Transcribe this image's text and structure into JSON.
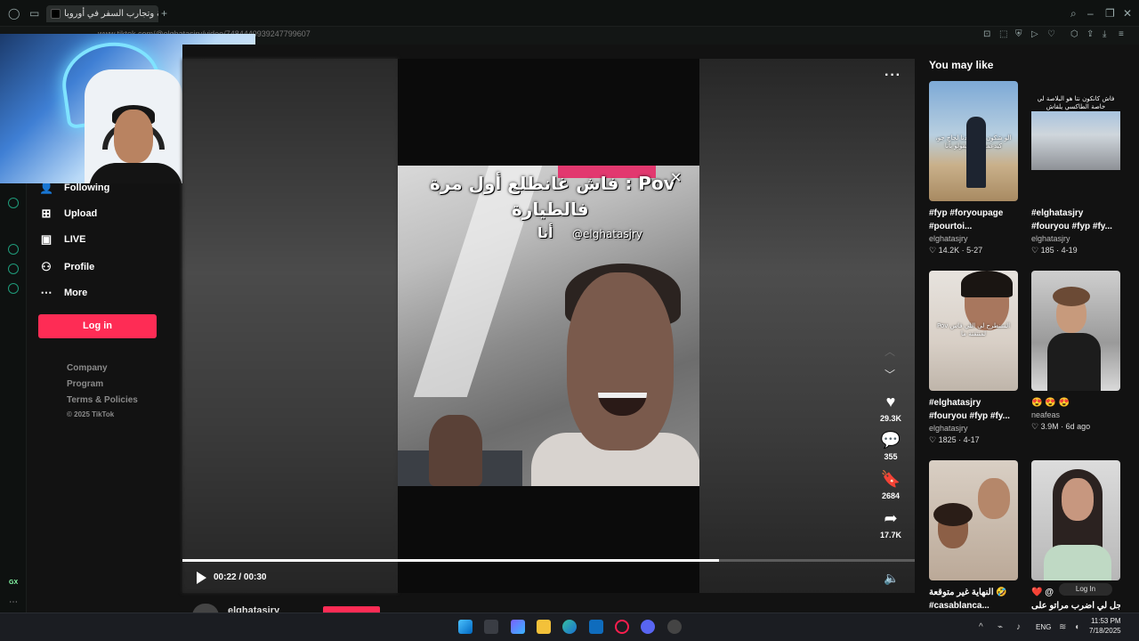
{
  "browser": {
    "tab_title": "القرية وتجارب السفر في أوروبا",
    "url": "www.tiktok.com/@elghatasjry/video/7484440939247799607"
  },
  "sidebar": {
    "items": [
      {
        "label": "Following",
        "icon": "following-icon"
      },
      {
        "label": "Upload",
        "icon": "upload-icon"
      },
      {
        "label": "LIVE",
        "icon": "live-icon"
      },
      {
        "label": "Profile",
        "icon": "profile-icon"
      },
      {
        "label": "More",
        "icon": "more-icon"
      }
    ],
    "login_label": "Log in",
    "footer": [
      "Company",
      "Program",
      "Terms & Policies"
    ],
    "copyright": "© 2025 TikTok"
  },
  "video": {
    "overlay_line1": "فاش غانطلع أول مرة : Pov",
    "overlay_line2": "فالطيارة",
    "overlay_line3": "أنا",
    "watermark": "@elghatasjry",
    "likes": "29.3K",
    "comments": "355",
    "saves": "2684",
    "shares": "17.7K",
    "time": "00:22 / 00:30",
    "progress": 0.733,
    "author": "elghatasjry"
  },
  "rail": {
    "title": "You may like",
    "cards": [
      {
        "title1": "#fyp #foryoupage",
        "title2": "#pourtoi...",
        "user": "elghatasjry",
        "likes": "14.2K",
        "date": "5-27",
        "caption": "الو شكون جي عندنا لجاج جو، كيدعمو تلي كيقولو بأنا"
      },
      {
        "title1": "#elghatasjry",
        "title2": "#fouryou #fyp #fy...",
        "user": "elghatasjry",
        "likes": "185",
        "date": "4-19",
        "caption": "فاش كانكون نتا هو البلاصة لي خاصة الطاكسي يلقاش"
      },
      {
        "title1": "#elghatasjry",
        "title2": "#fouryou #fyp #fy...",
        "user": "elghatasjry",
        "likes": "1825",
        "date": "4-17",
        "caption": "Pov السنطرح لي اللي فاس لمنتقنة ما"
      },
      {
        "title1": "😍 😍 😍",
        "title2": "",
        "user": "neafeas",
        "likes": "3.9M",
        "date": "6d ago",
        "caption": ""
      },
      {
        "title1": "النهاية غير متوقعة 🤣",
        "title2": "#casablanca...",
        "user": "",
        "likes": "",
        "date": "",
        "caption": ""
      },
      {
        "title1": "❤️ @",
        "title2": "راجل لي اضرب مراتو على...",
        "user": "",
        "likes": "",
        "date": "",
        "caption": ""
      }
    ],
    "login_chip": "Log In"
  },
  "taskbar": {
    "lang": "ENG",
    "time": "11:53 PM",
    "date": "7/18/2025"
  },
  "gx_label": "GX"
}
